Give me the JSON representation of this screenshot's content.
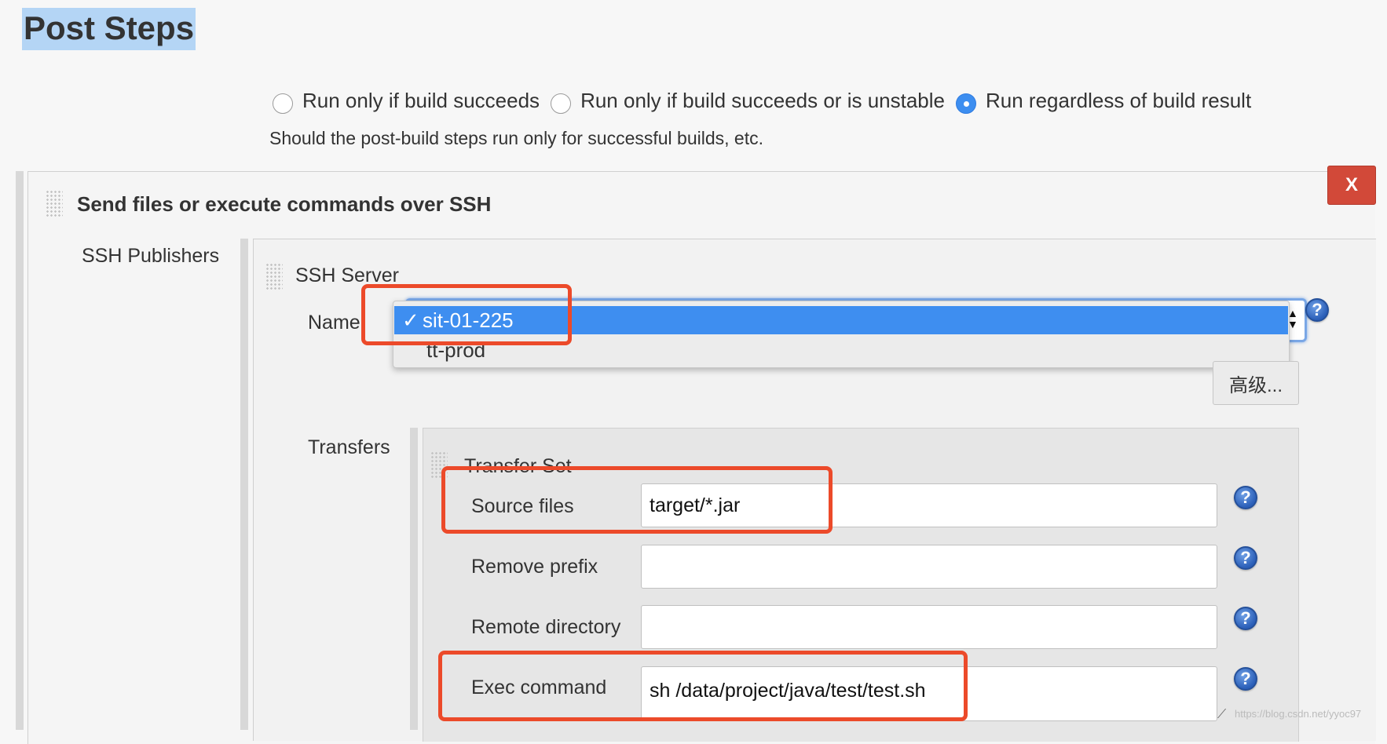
{
  "section": {
    "title": "Post Steps"
  },
  "run_condition": {
    "options": [
      {
        "label": "Run only if build succeeds",
        "checked": false
      },
      {
        "label": "Run only if build succeeds or is unstable",
        "checked": false
      },
      {
        "label": "Run regardless of build result",
        "checked": true
      }
    ],
    "help": "Should the post-build steps run only for successful builds, etc."
  },
  "ssh_step": {
    "header": "Send files or execute commands over SSH",
    "delete_label": "X",
    "publishers_label": "SSH Publishers",
    "server": {
      "label": "SSH Server",
      "name_label": "Name",
      "options": [
        "sit-01-225",
        "tt-prod"
      ],
      "selected": "sit-01-225",
      "check_mark": "✓",
      "advanced_label": "高级..."
    },
    "transfers": {
      "label": "Transfers",
      "set_label": "Transfer Set",
      "fields": {
        "source_files": {
          "label": "Source files",
          "value": "target/*.jar"
        },
        "remove_prefix": {
          "label": "Remove prefix",
          "value": ""
        },
        "remote_directory": {
          "label": "Remote directory",
          "value": ""
        },
        "exec_command": {
          "label": "Exec command",
          "value": "sh /data/project/java/test/test.sh"
        }
      }
    },
    "help_icon_glyph": "?"
  },
  "watermark": "https://blog.csdn.net/yyoc97",
  "colors": {
    "accent": "#3e8ef0",
    "highlight": "#ec4a2a",
    "delete": "#d24939"
  }
}
